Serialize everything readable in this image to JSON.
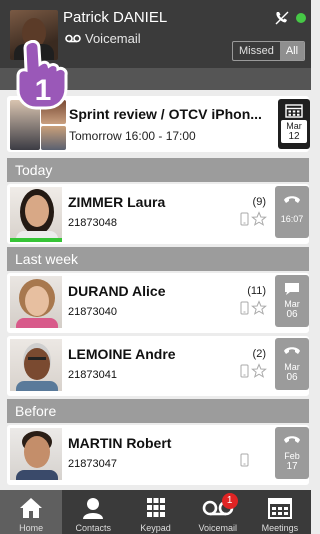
{
  "header": {
    "user_name": "Patrick DANIEL",
    "voicemail_label": "Voicemail",
    "filter_missed": "Missed",
    "filter_all": "All",
    "presence_color": "#46c846"
  },
  "annotation": {
    "step_number": "1"
  },
  "meeting": {
    "title": "Sprint review / OTCV iPhon...",
    "time": "Tomorrow 16:00 - 17:00",
    "month": "Mar",
    "day": "12"
  },
  "sections": {
    "today": "Today",
    "last_week": "Last week",
    "before": "Before"
  },
  "contacts": [
    {
      "name": "ZIMMER Laura",
      "number": "21873048",
      "count": "(9)",
      "tile_icon": "phone-icon",
      "tile_text_1": "16:07",
      "tile_text_2": ""
    },
    {
      "name": "DURAND Alice",
      "number": "21873040",
      "count": "(11)",
      "tile_icon": "message-icon",
      "tile_text_1": "Mar",
      "tile_text_2": "06"
    },
    {
      "name": "LEMOINE Andre",
      "number": "21873041",
      "count": "(2)",
      "tile_icon": "phone-icon",
      "tile_text_1": "Mar",
      "tile_text_2": "06"
    },
    {
      "name": "MARTIN Robert",
      "number": "21873047",
      "count": "",
      "tile_icon": "phone-icon",
      "tile_text_1": "Feb",
      "tile_text_2": "17"
    }
  ],
  "tabs": [
    {
      "label": "Home",
      "icon": "home-icon"
    },
    {
      "label": "Contacts",
      "icon": "contacts-icon"
    },
    {
      "label": "Keypad",
      "icon": "keypad-icon"
    },
    {
      "label": "Voicemail",
      "icon": "voicemail-icon",
      "badge": "1"
    },
    {
      "label": "Meetings",
      "icon": "calendar-icon"
    }
  ]
}
